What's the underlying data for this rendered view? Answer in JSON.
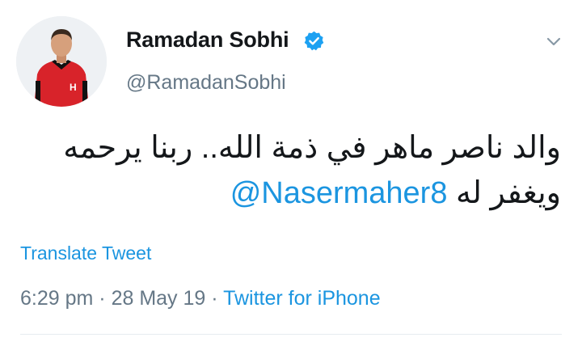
{
  "user": {
    "display_name": "Ramadan Sobhi",
    "handle": "@RamadanSobhi",
    "verified": true,
    "avatar_icon": "player-avatar"
  },
  "tweet": {
    "text_line1": "والد ناصر ماهر في ذمة الله.. ربنا يرحمه",
    "text_line2_prefix": "ويغفر له ",
    "mention": "@Nasermaher8",
    "translate_label": "Translate Tweet",
    "time": "6:29 pm",
    "separator": " · ",
    "date": "28 May 19",
    "source": "Twitter for iPhone"
  },
  "icons": {
    "verified": "verified-badge-icon",
    "menu": "chevron-down-icon"
  },
  "colors": {
    "link": "#1b95e0",
    "secondary_text": "#657786",
    "primary_text": "#14171a",
    "verified": "#1da1f2"
  }
}
